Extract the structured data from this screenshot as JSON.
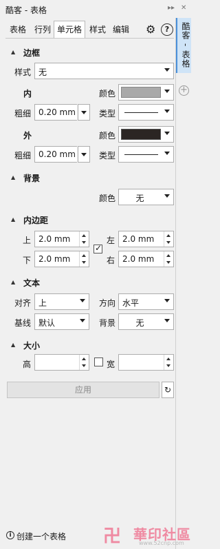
{
  "window": {
    "title": "酷客 - 表格",
    "expand_glyph": "▸▸",
    "close_glyph": "✕"
  },
  "tabs": [
    {
      "label": "表格"
    },
    {
      "label": "行列"
    },
    {
      "label": "单元格"
    },
    {
      "label": "样式"
    },
    {
      "label": "编辑"
    }
  ],
  "active_tab": "单元格",
  "icons": {
    "settings": "gear-icon",
    "help": "help-icon",
    "help_glyph": "?",
    "settings_glyph": "⚙",
    "reset_glyph": "↻",
    "info_glyph": "i",
    "add_glyph": "+",
    "check_glyph": "✓"
  },
  "border": {
    "heading": "边框",
    "style_label": "样式",
    "style_value": "无",
    "inner": {
      "heading": "内",
      "color_label": "颜色",
      "color": "#a9a9a9",
      "weight_label": "粗细",
      "weight_value": "0.20 mm",
      "type_label": "类型"
    },
    "outer": {
      "heading": "外",
      "color_label": "颜色",
      "color": "#2b2523",
      "weight_label": "粗细",
      "weight_value": "0.20 mm",
      "type_label": "类型"
    }
  },
  "background": {
    "heading": "背景",
    "color_label": "颜色",
    "color_value": "无"
  },
  "padding": {
    "heading": "内边距",
    "top_label": "上",
    "top_value": "2.0 mm",
    "bottom_label": "下",
    "bottom_value": "2.0 mm",
    "left_label": "左",
    "left_value": "2.0 mm",
    "right_label": "右",
    "right_value": "2.0 mm",
    "linked": true
  },
  "text": {
    "heading": "文本",
    "align_label": "对齐",
    "align_value": "上",
    "direction_label": "方向",
    "direction_value": "水平",
    "baseline_label": "基线",
    "baseline_value": "默认",
    "background_label": "背景",
    "background_value": "无"
  },
  "size": {
    "heading": "大小",
    "height_label": "高",
    "height_value": "",
    "width_label": "宽",
    "width_value": "",
    "locked": false
  },
  "actions": {
    "apply_label": "应用"
  },
  "status": {
    "text": "创建一个表格"
  },
  "side_rail": {
    "tab_label": "酷客 - 表格"
  },
  "watermark": {
    "glyph": "卍",
    "text": "華印社區",
    "url": "www.52cnp.com"
  }
}
